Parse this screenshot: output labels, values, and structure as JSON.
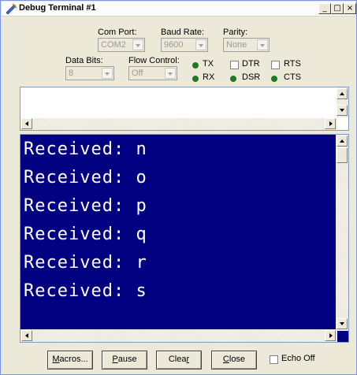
{
  "window": {
    "title": "Debug Terminal #1",
    "minimize_glyph": "_",
    "maximize_glyph": "□",
    "close_glyph": "×"
  },
  "settings": {
    "com_port": {
      "label": "Com Port:",
      "value": "COM2"
    },
    "baud_rate": {
      "label": "Baud Rate:",
      "value": "9600"
    },
    "parity": {
      "label": "Parity:",
      "value": "None"
    },
    "data_bits": {
      "label": "Data Bits:",
      "value": "8"
    },
    "flow_control": {
      "label": "Flow Control:",
      "value": "Off"
    }
  },
  "indicators": {
    "tx": "TX",
    "rx": "RX",
    "dtr": "DTR",
    "rts": "RTS",
    "dsr": "DSR",
    "cts": "CTS",
    "led_color": "#1f7a1f"
  },
  "receive_lines": [
    "Received: n",
    "Received: o",
    "Received: p",
    "Received: q",
    "Received: r",
    "Received: s"
  ],
  "colors": {
    "receive_background": "#000080",
    "receive_text": "#ffffff"
  },
  "buttons": {
    "macros": {
      "mnemonic": "M",
      "rest": "acros..."
    },
    "pause": {
      "mnemonic": "P",
      "rest": "ause"
    },
    "clear": {
      "pre": "Clea",
      "mnemonic": "r"
    },
    "close": {
      "mnemonic": "C",
      "rest": "lose"
    },
    "echo_off": "Echo Off"
  }
}
